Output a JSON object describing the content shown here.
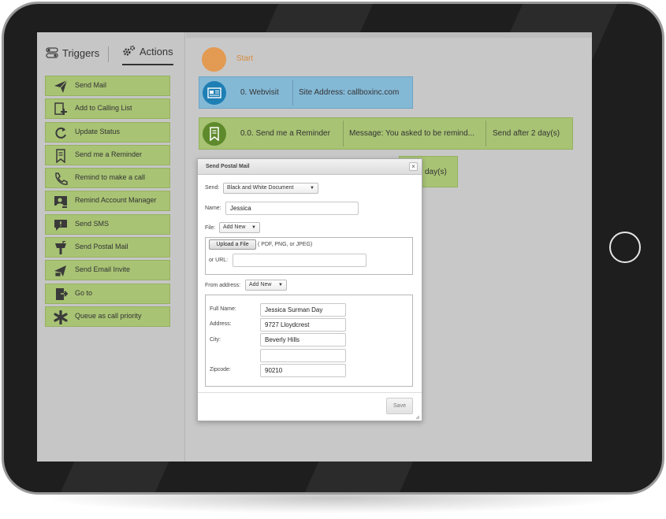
{
  "sidebar": {
    "tabs": [
      {
        "label": "Triggers",
        "icon": "toggles-icon"
      },
      {
        "label": "Actions",
        "icon": "gears-icon"
      }
    ],
    "actions": [
      {
        "label": "Send Mail",
        "icon": "paper-plane-icon"
      },
      {
        "label": "Add to Calling List",
        "icon": "add-list-icon"
      },
      {
        "label": "Update Status",
        "icon": "refresh-icon"
      },
      {
        "label": "Send me a Reminder",
        "icon": "bookmark-icon"
      },
      {
        "label": "Remind to make a call",
        "icon": "phone-icon"
      },
      {
        "label": "Remind Account Manager",
        "icon": "account-manager-icon"
      },
      {
        "label": "Send SMS",
        "icon": "sms-icon"
      },
      {
        "label": "Send Postal Mail",
        "icon": "mailbox-icon"
      },
      {
        "label": "Send Email Invite",
        "icon": "email-invite-icon"
      },
      {
        "label": "Go to",
        "icon": "goto-icon"
      },
      {
        "label": "Queue as call priority",
        "icon": "asterisk-icon"
      }
    ]
  },
  "flow": {
    "start_label": "Start",
    "webvisit": {
      "name": "0. Webvisit",
      "detail": "Site Address: callboxinc.com"
    },
    "reminder": {
      "name": "0.0. Send me a Reminder",
      "message": "Message: You asked to be remind...",
      "timing": "Send after 2 day(s)"
    },
    "partial_text": "day(s)"
  },
  "modal": {
    "title": "Send Postal Mail",
    "close": "×",
    "send_label": "Send:",
    "send_value": "Black and White Document",
    "name_label": "Name:",
    "name_value": "Jessica",
    "file_label": "File:",
    "file_select": "Add New",
    "upload_button": "Upload a File",
    "upload_hint": "( PDF, PNG, or JPEG)",
    "url_label": "or URL:",
    "url_value": "",
    "from_label": "From address:",
    "from_select": "Add New",
    "fullname_label": "Full Name:",
    "fullname_value": "Jessica Surman Day",
    "address_label": "Address:",
    "address_value": "9727 Lloydcrest",
    "city_label": "City:",
    "city_value": "Beverly Hills",
    "extra_value": "",
    "zip_label": "Zipcode:",
    "zip_value": "90210",
    "save_button": "Save"
  },
  "colors": {
    "action_green": "#a8c374",
    "webvisit_blue": "#84b9d6",
    "start_orange": "#e39a52"
  }
}
